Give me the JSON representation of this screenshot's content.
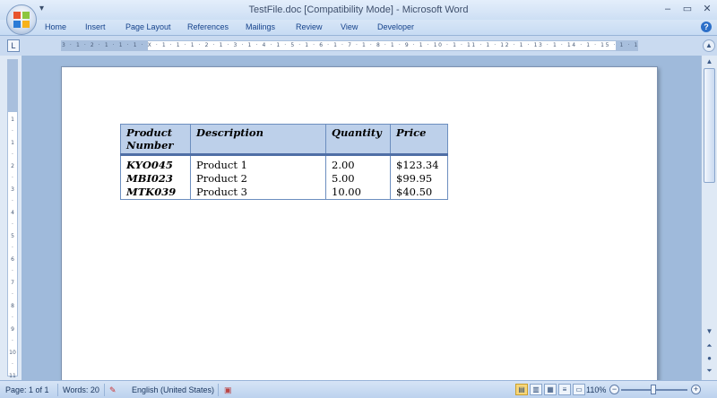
{
  "window": {
    "title": "TestFile.doc [Compatibility Mode] - Microsoft Word",
    "qat_glyph": "▾",
    "controls": {
      "minimize": "–",
      "maximize": "▭",
      "close": "✕"
    }
  },
  "ribbon": {
    "tabs": [
      "Home",
      "Insert",
      "Page Layout",
      "References",
      "Mailings",
      "Review",
      "View",
      "Developer"
    ],
    "help": "?"
  },
  "ruler": {
    "tab_selector": "L",
    "h_numbers": "3 · 1 · 2 · 1 · 1 · 1 · X · 1 · 1 · 1 · 2 · 1 · 3 · 1 · 4 · 1 · 5 · 1 · 6 · 1 · 7 · 1 · 8 · 1 · 9 · 1 · 10 · 1 · 11 · 1 · 12 · 1 · 13 · 1 · 14 · 1 · 15 · 1 · 16 · ⌂ · 17 · 1",
    "v_numbers": [
      "1",
      "·",
      "1",
      "·",
      "2",
      "·",
      "3",
      "·",
      "4",
      "·",
      "5",
      "·",
      "6",
      "·",
      "7",
      "·",
      "8",
      "·",
      "9",
      "·",
      "10",
      "·",
      "11"
    ]
  },
  "table": {
    "headers": [
      "Product Number",
      "Description",
      "Quantity",
      "Price"
    ],
    "rows": [
      [
        "KYO045",
        "Product 1",
        "2.00",
        "$123.34"
      ],
      [
        "MBI023",
        "Product 2",
        "5.00",
        "$99.95"
      ],
      [
        "MTK039",
        "Product 3",
        "10.00",
        "$40.50"
      ]
    ]
  },
  "statusbar": {
    "page": "Page: 1 of 1",
    "words": "Words: 20",
    "language": "English (United States)",
    "zoom": "110%"
  },
  "colors": {
    "header_fill": "#bdd0ea",
    "table_border": "#6c8ebf",
    "office_logo": [
      "#e8542c",
      "#8cc63f",
      "#2b7bd6",
      "#f7b21b"
    ]
  }
}
